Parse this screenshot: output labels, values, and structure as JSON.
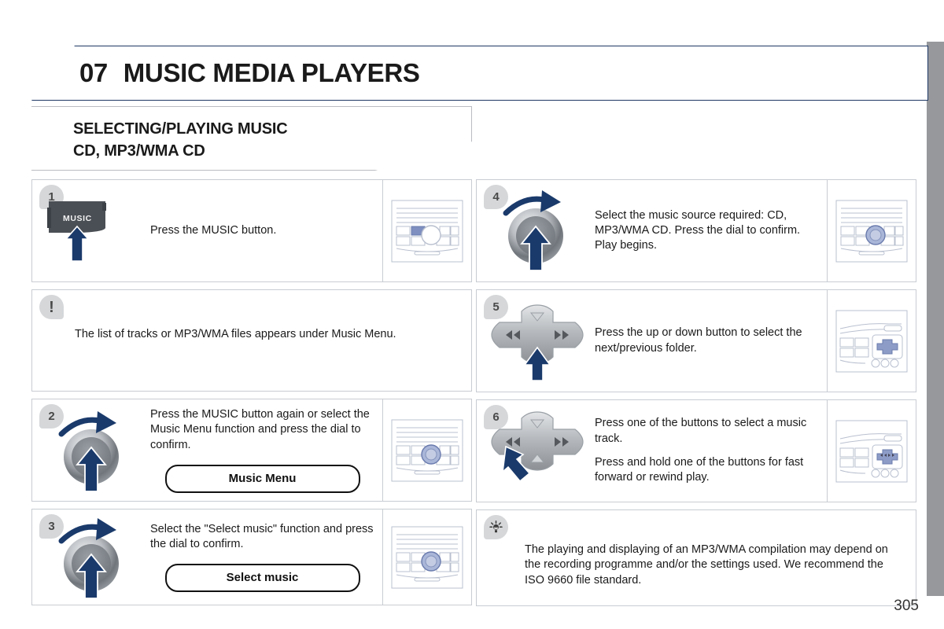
{
  "header": {
    "chapter_number": "07",
    "chapter_title": "MUSIC MEDIA PLAYERS"
  },
  "section": {
    "line1": "SELECTING/PLAYING MUSIC",
    "line2": "CD, MP3/WMA CD"
  },
  "left_column": [
    {
      "kind": "step",
      "badge": "1",
      "graphic": "music-button-graphic",
      "text": [
        "Press the MUSIC button."
      ],
      "thumbnail": "radio-panel-music-highlight"
    },
    {
      "kind": "note",
      "badge": "!",
      "text": "The list of tracks or MP3/WMA files appears under Music Menu."
    },
    {
      "kind": "step",
      "badge": "2",
      "graphic": "rotary-dial-graphic",
      "text": [
        "Press the MUSIC button again or select the Music Menu function and press the dial to confirm."
      ],
      "pill": "Music Menu",
      "thumbnail": "radio-panel-dial-highlight"
    },
    {
      "kind": "step",
      "badge": "3",
      "graphic": "rotary-dial-graphic",
      "text": [
        "Select the \"Select music\" function and press the dial to confirm."
      ],
      "pill": "Select music",
      "thumbnail": "radio-panel-dial-highlight"
    }
  ],
  "right_column": [
    {
      "kind": "step",
      "badge": "4",
      "graphic": "rotary-dial-graphic",
      "text": [
        "Select the music source required: CD, MP3/WMA CD. Press the dial to confirm. Play begins."
      ],
      "thumbnail": "radio-panel-dial-highlight"
    },
    {
      "kind": "step",
      "badge": "5",
      "graphic": "dpad-graphic-down",
      "text": [
        "Press the up or down button to select the next/previous folder."
      ],
      "thumbnail": "console-panel-dpad"
    },
    {
      "kind": "step",
      "badge": "6",
      "graphic": "dpad-graphic-left",
      "text": [
        "Press one of the buttons to select a music track.",
        "Press and hold one of the buttons for fast forward or rewind play."
      ],
      "thumbnail": "console-panel-dpad"
    },
    {
      "kind": "tip",
      "badge": "tip-bulb-icon",
      "text": "The playing and displaying of an MP3/WMA compilation may depend on the recording programme and/or the settings used. We recommend the ISO 9660 file standard."
    }
  ],
  "music_button_label": "MUSIC",
  "page_number": "305",
  "colors": {
    "header_border": "#1f3864",
    "panel_border": "#c8ccd2",
    "badge_bg": "#d5d7d9",
    "arrow_navy": "#1a3a6b",
    "edge_tab": "#96989c",
    "music_button": "#4a4f55",
    "dial_gray": "#8c9095",
    "thumb_line": "#b9c0cf",
    "thumb_highlight": "#7e8fc0"
  }
}
